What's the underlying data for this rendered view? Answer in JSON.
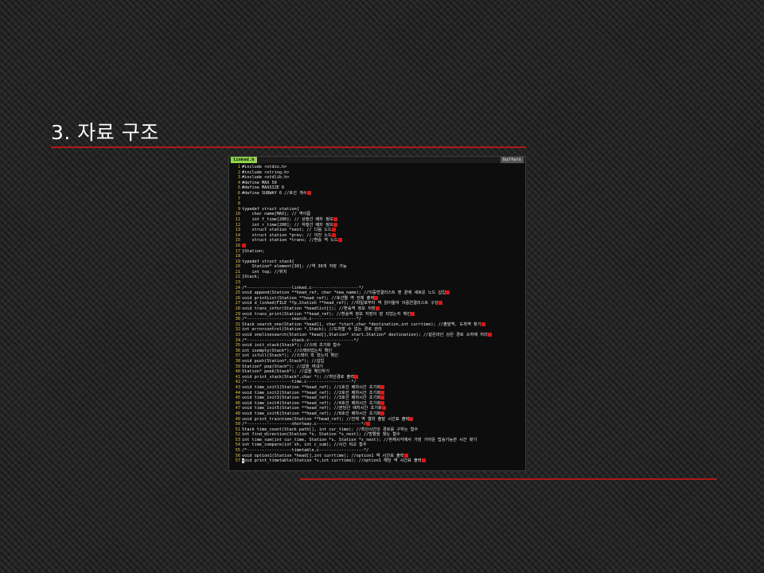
{
  "slide": {
    "title": "3. 자료 구조"
  },
  "editor": {
    "tab_label": "linked.h",
    "buffers_label": "buffers",
    "lines": [
      {
        "n": "1",
        "t": "#include <stdio.h>"
      },
      {
        "n": "2",
        "t": "#include <string.h>"
      },
      {
        "n": "3",
        "t": "#include <stdlib.h>"
      },
      {
        "n": "4",
        "t": "#define MAX 50"
      },
      {
        "n": "5",
        "t": "#define MAXSIZE 6"
      },
      {
        "n": "6",
        "t": "#define SUBWAY 6 //호선 개수",
        "m": true
      },
      {
        "n": "7",
        "t": ""
      },
      {
        "n": "8",
        "t": ""
      },
      {
        "n": "9",
        "t": "typedef struct station{"
      },
      {
        "n": "10",
        "t": "    char name[MAX]; // 역이름"
      },
      {
        "n": "11",
        "t": "    int f_time[200]; // 상행선 배차 정보",
        "m": true
      },
      {
        "n": "12",
        "t": "    int r_time[200]; // 하행선 배차 정보",
        "m": true
      },
      {
        "n": "13",
        "t": "    struct station *next; // 다음 노드",
        "m": true
      },
      {
        "n": "14",
        "t": "    struct station *prev; // 이전 노드",
        "m": true
      },
      {
        "n": "15",
        "t": "    struct station *trans; //환승 역 노드",
        "m": true
      },
      {
        "n": "16",
        "t": "",
        "m": true
      },
      {
        "n": "17",
        "t": "}Station;"
      },
      {
        "n": "18",
        "t": ""
      },
      {
        "n": "19",
        "t": "typedef struct stack{"
      },
      {
        "n": "20",
        "t": "    Station* element[30]; //역 30개 저장 가능"
      },
      {
        "n": "21",
        "t": "    int top; //위치"
      },
      {
        "n": "22",
        "t": "}Stack;"
      },
      {
        "n": "23",
        "t": ""
      },
      {
        "n": "24",
        "t": "/*------------------linked.c-------------------*/"
      },
      {
        "n": "25",
        "t": "void append(Station **head_ref, char *new_name); //이중연결리스트 맨 끝에 새로운 노드 삽입",
        "m": true
      },
      {
        "n": "26",
        "t": "void printList(Station **head_ref); //호선별 역 전체 출력",
        "m": true
      },
      {
        "n": "27",
        "t": "void d_linked(FILE *fp,Station **head_ref); //파일로부터 역 읽어들여 이중연결리스트 구성",
        "m": true
      },
      {
        "n": "28",
        "t": "void trans_infor(Station *headlist[]); //환승역 정보 저장",
        "m": true
      },
      {
        "n": "29",
        "t": "void trans_print(Station **head_ref); //환승역 정보 저장이 잘 되었는지 확인",
        "m": true
      },
      {
        "n": "30",
        "t": "/*------------------search.c------------------*/"
      },
      {
        "n": "31",
        "t": "Stack search_one(Station *head[], char *start,char *destination,int currtime); //출발역, 도착역 찾기",
        "m": true
      },
      {
        "n": "32",
        "t": "int errorcontrol(Station *,Stack); //도착할 수 없는 경로 관리"
      },
      {
        "n": "33",
        "t": "void onelinesearch(Station *head[],Station* start,Station* destination); //같은라인 상은 경로 소하에 처리",
        "m": true
      },
      {
        "n": "34",
        "t": "/*------------------stack.c------------------*/"
      },
      {
        "n": "35",
        "t": "void init_stack(Stack*); //스택 초기화 함수"
      },
      {
        "n": "36",
        "t": "int isempty(Stack*); //스택비었는지 확인"
      },
      {
        "n": "37",
        "t": "int isfull(Stack*); //스택이 꽉 찼는지 확인"
      },
      {
        "n": "38",
        "t": "void push(Station*,Stack*); //삽입"
      },
      {
        "n": "39",
        "t": "Station* pop(Stack*); //값을 꺼내기"
      },
      {
        "n": "40",
        "t": "Station* peek(Stack*); //값을 확인하기"
      },
      {
        "n": "41",
        "t": "void print_stack(Stack*,char *); //최단경로 출력",
        "m": true
      },
      {
        "n": "42",
        "t": "/*------------------time.c------------------*/"
      },
      {
        "n": "43",
        "t": "void time_init1(Station **head_ref); //1호선 배차시간 초기화",
        "m": true
      },
      {
        "n": "44",
        "t": "void time_init2(Station **head_ref); //2호선 배차시간 초기화",
        "m": true
      },
      {
        "n": "45",
        "t": "void time_init3(Station **head_ref); //3호선 배차시간 초기화",
        "m": true
      },
      {
        "n": "46",
        "t": "void time_init4(Station **head_ref); //4호선 배차시간 초기화",
        "m": true
      },
      {
        "n": "47",
        "t": "void time_init5(Station **head_ref); //분당선 배차시간 초기화",
        "m": true
      },
      {
        "n": "48",
        "t": "void time_init6(Station **head_ref); //8호선 배차시간 초기화",
        "m": true
      },
      {
        "n": "49",
        "t": "void print_traintime(Station **head_ref); //전체 역 열차 출발 시간표 출력",
        "m": true
      },
      {
        "n": "50",
        "t": "/*------------------shortway.c------------------*/",
        "m": true
      },
      {
        "n": "51",
        "t": "Stack time_count(Stack path[], int cur_time); //최단시간의 경로를 구하는 함수"
      },
      {
        "n": "52",
        "t": "int find_direction(Station *s, Station *s_next); //방향을 찾는 함수"
      },
      {
        "n": "53",
        "t": "int time_sum(int cur_time, Station *s, Station *s_next); //현재시각에서 가장 가까운 탑승가능한 시간 찾기"
      },
      {
        "n": "54",
        "t": "int time_compare(int sh, int c_sum); //시간 비교 함수"
      },
      {
        "n": "55",
        "t": "/*------------------timetable.c------------------*/"
      },
      {
        "n": "56",
        "t": "void option1(Station *head[],int currtime); //option1 역 시간표 출력",
        "m": true
      },
      {
        "n": "57",
        "t": "void print_timetable(Station *s,int currtime); //option1 해당 역 시간표 출력",
        "m": true
      }
    ]
  }
}
